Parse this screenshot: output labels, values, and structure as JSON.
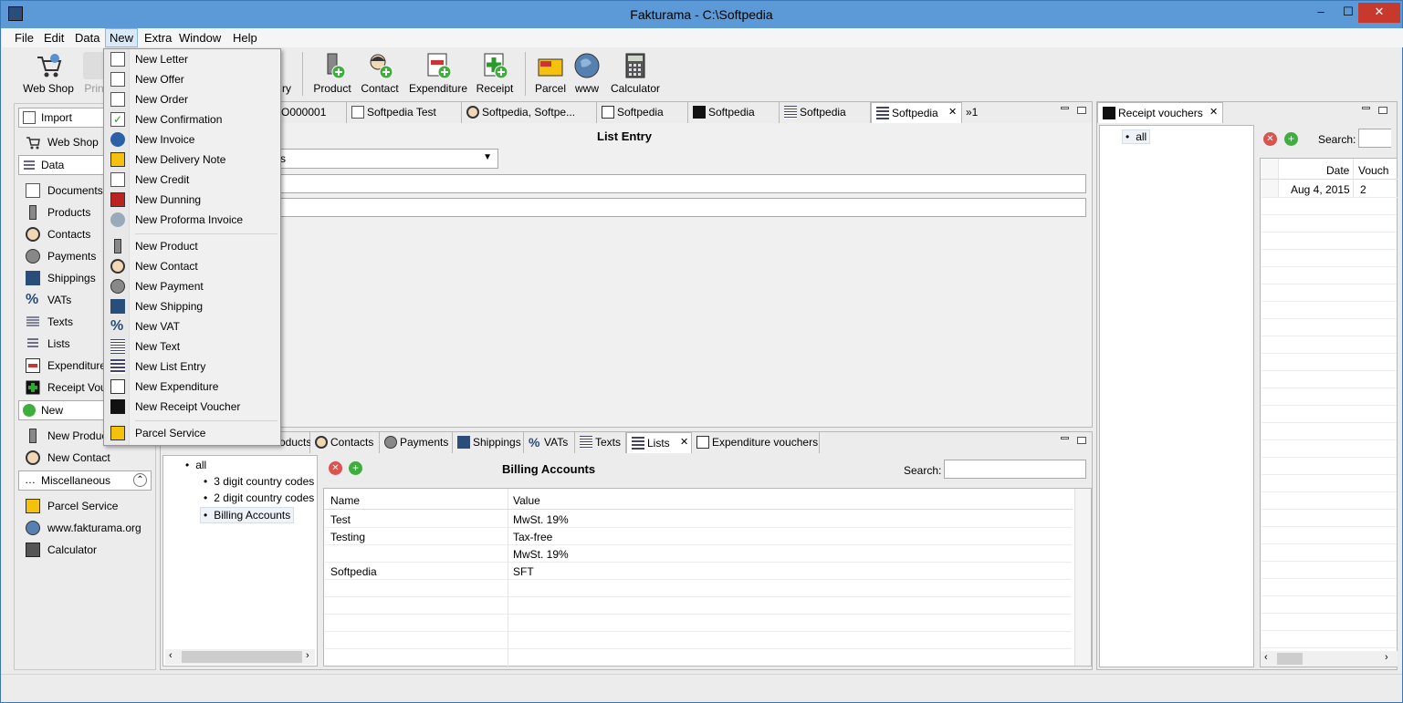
{
  "window": {
    "title": "Fakturama - C:\\Softpedia",
    "minimize": "–",
    "maximize": "☐",
    "close": "✕"
  },
  "menubar": [
    "File",
    "Edit",
    "Data",
    "New",
    "Extra",
    "Window",
    "Help"
  ],
  "toolbar": {
    "items": [
      "Web Shop",
      "Prin",
      "ry",
      "Product",
      "Contact",
      "Expenditure",
      "Receipt",
      "Parcel",
      "www",
      "Calculator"
    ]
  },
  "leftnav": {
    "import_label": "Import",
    "web_shop": "Web Shop",
    "data_label": "Data",
    "data_items": [
      "Documents",
      "Products",
      "Contacts",
      "Payments",
      "Shippings",
      "VATs",
      "Texts",
      "Lists",
      "Expenditure",
      "Receipt Vou"
    ],
    "new_label": "New",
    "new_items": [
      "New Produc",
      "New Contact"
    ],
    "misc_label": "Miscellaneous",
    "misc_items": [
      "Parcel Service",
      "www.fakturama.org",
      "Calculator"
    ]
  },
  "new_menu": {
    "group1": [
      "New Letter",
      "New Offer",
      "New Order",
      "New Confirmation",
      "New Invoice",
      "New Delivery Note",
      "New Credit",
      "New Dunning",
      "New Proforma Invoice"
    ],
    "group2": [
      "New Product",
      "New Contact",
      "New Payment",
      "New Shipping",
      "New VAT",
      "New Text",
      "New List Entry",
      "New Expenditure",
      "New Receipt Voucher"
    ],
    "group3": [
      "Parcel Service"
    ]
  },
  "editor_tabs": [
    "O000001",
    "Softpedia Test",
    "Softpedia, Softpe...",
    "Softpedia",
    "Softpedia",
    "Softpedia",
    "Softpedia",
    "»1"
  ],
  "list_entry": {
    "heading": "List Entry",
    "category_value": "s"
  },
  "bottom_tabs": [
    "oducts",
    "Contacts",
    "Payments",
    "Shippings",
    "VATs",
    "Texts",
    "Lists",
    "Expenditure vouchers"
  ],
  "lists_view": {
    "tree": [
      "all",
      "3 digit country codes",
      "2 digit country codes",
      "Billing Accounts"
    ],
    "heading": "Billing Accounts",
    "search_label": "Search:",
    "columns": [
      "Name",
      "Value"
    ],
    "rows": [
      [
        "Test",
        "MwSt. 19%"
      ],
      [
        "Testing",
        "Tax-free"
      ],
      [
        "",
        "MwSt. 19%"
      ],
      [
        "Softpedia",
        "SFT"
      ]
    ]
  },
  "receipt_vouchers": {
    "tab_label": "Receipt vouchers",
    "tree": [
      "all"
    ],
    "search_label": "Search:",
    "columns": [
      "Date",
      "Vouch"
    ],
    "rows": [
      [
        "Aug 4, 2015",
        "2"
      ]
    ]
  },
  "colors": {
    "accent": "#5b9ad6",
    "close_red": "#c7392d",
    "menu_highlight": "#dbe8f6"
  }
}
